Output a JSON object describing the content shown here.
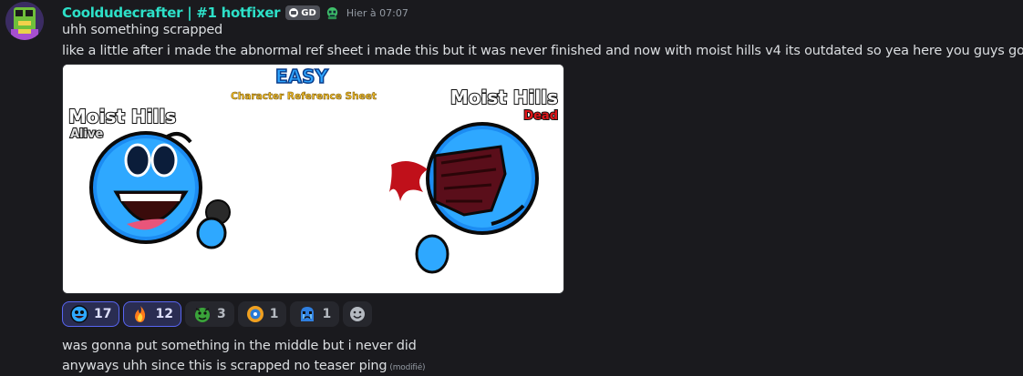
{
  "author": {
    "username": "Cooldudecrafter | #1 hotfixer",
    "tag": "GD",
    "timestamp": "Hier à 07:07"
  },
  "messages": [
    {
      "text": "uhh something scrapped"
    },
    {
      "text": "like a little after i made the abnormal ref sheet i made this but it was never finished and now with moist hills v4 its outdated so yea here you guys go lmao"
    },
    {
      "text": "was gonna put something in the middle but i never did"
    },
    {
      "text": "anyways uhh since this is scrapped no teaser ping",
      "edited": "(modifié)"
    }
  ],
  "image": {
    "difficulty": "EASY",
    "subtitle": "Character Reference Sheet",
    "left_title": "Moist Hills",
    "left_state": "Alive",
    "right_title": "Moist Hills",
    "right_state": "Dead"
  },
  "reactions": [
    {
      "icon": "easy-face-icon",
      "count": "17",
      "active": true
    },
    {
      "icon": "fire-icon",
      "count": "12",
      "active": true
    },
    {
      "icon": "green-face-icon",
      "count": "3",
      "active": false
    },
    {
      "icon": "orange-face-icon",
      "count": "1",
      "active": false
    },
    {
      "icon": "crying-face-icon",
      "count": "1",
      "active": false
    }
  ],
  "colors": {
    "username": "#2de0c8",
    "background": "#1a1a1e",
    "reaction_active_border": "#5865f2"
  }
}
